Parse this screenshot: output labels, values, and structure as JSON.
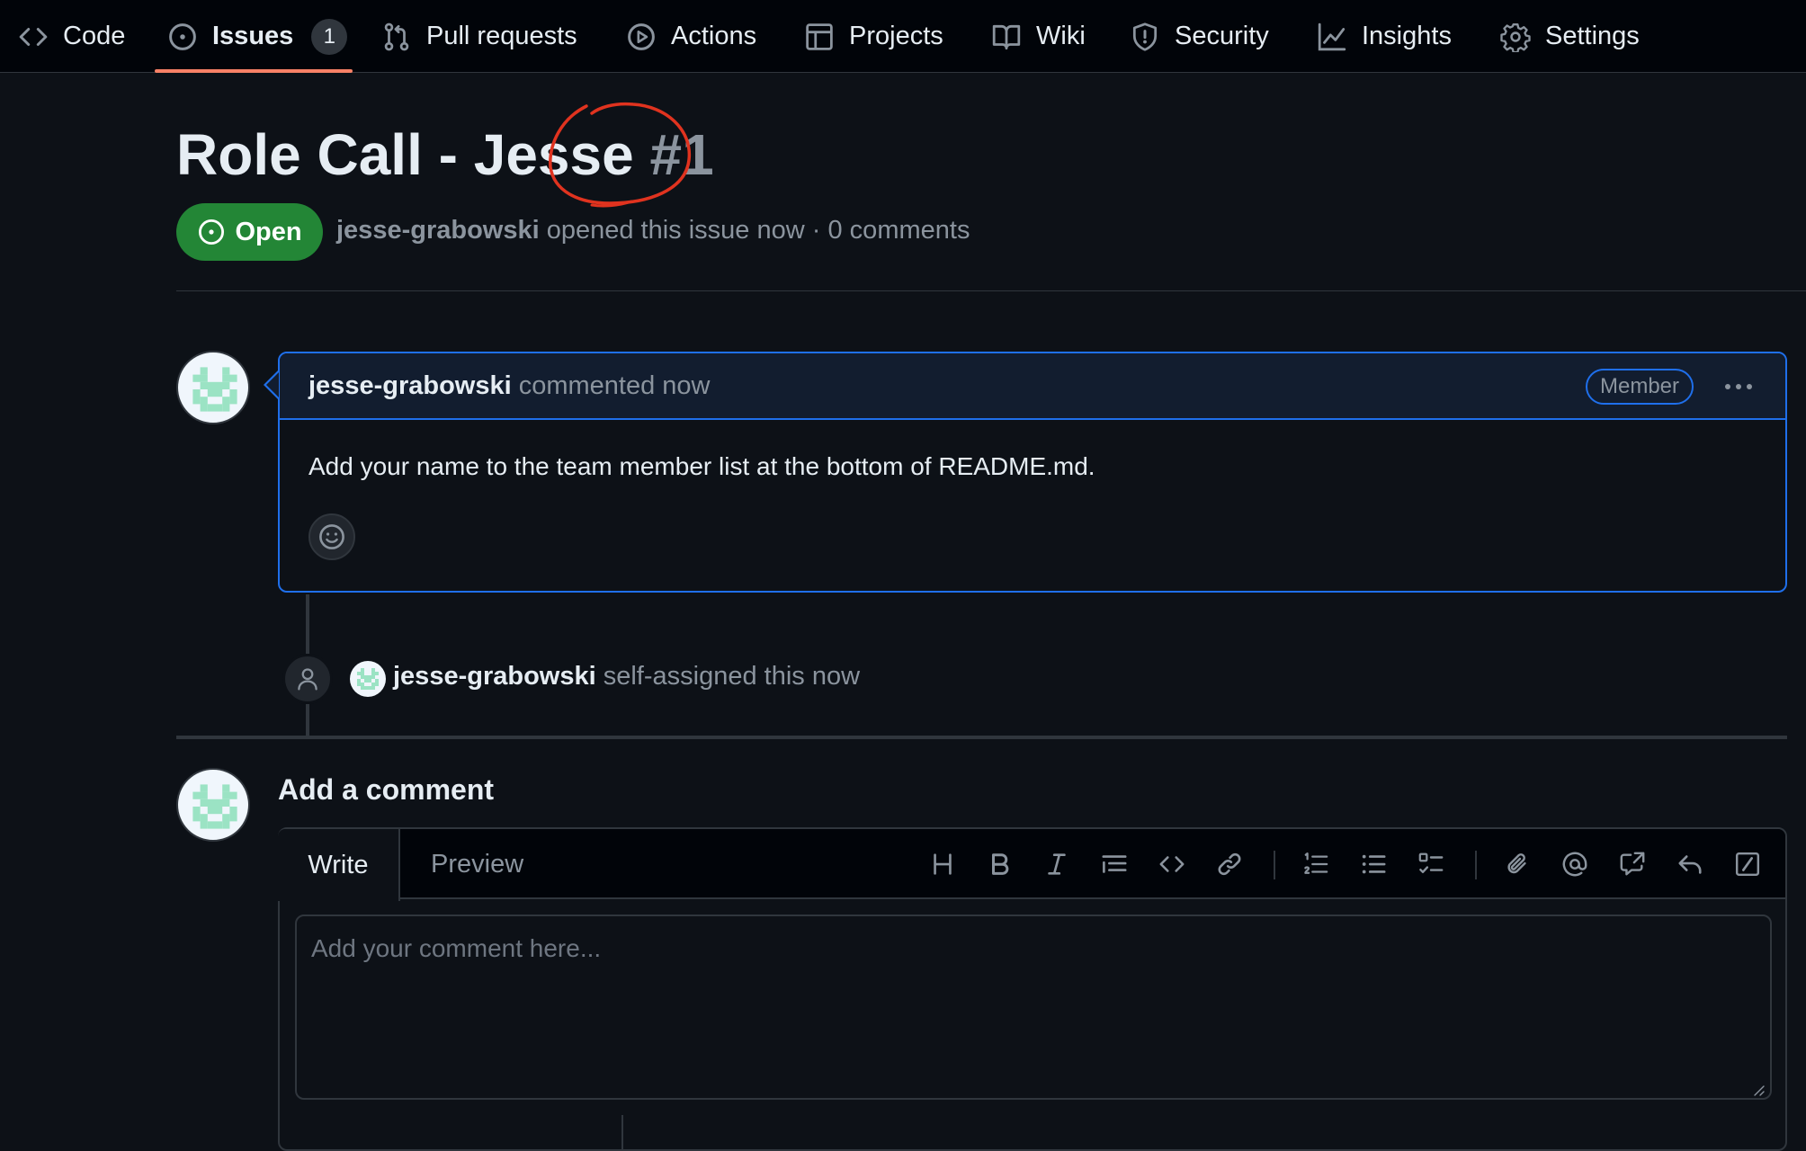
{
  "nav": {
    "items": [
      {
        "id": "code",
        "label": "Code",
        "icon": "code-icon"
      },
      {
        "id": "issues",
        "label": "Issues",
        "icon": "issue-opened-icon",
        "count": "1",
        "active": true
      },
      {
        "id": "pulls",
        "label": "Pull requests",
        "icon": "git-pull-request-icon"
      },
      {
        "id": "actions",
        "label": "Actions",
        "icon": "play-icon"
      },
      {
        "id": "projects",
        "label": "Projects",
        "icon": "table-icon"
      },
      {
        "id": "wiki",
        "label": "Wiki",
        "icon": "book-icon"
      },
      {
        "id": "security",
        "label": "Security",
        "icon": "shield-icon"
      },
      {
        "id": "insights",
        "label": "Insights",
        "icon": "graph-icon"
      },
      {
        "id": "settings",
        "label": "Settings",
        "icon": "gear-icon"
      }
    ],
    "accent": "#f78166"
  },
  "issue": {
    "title": "Role Call - Jesse",
    "number": "#1",
    "status": "Open",
    "status_color": "#238636",
    "author": "jesse-grabowski",
    "meta_action": "opened this issue now",
    "meta_sep": "·",
    "comment_count": "0 comments",
    "annotation_color": "#e0331f"
  },
  "comment": {
    "author": "jesse-grabowski",
    "action": "commented now",
    "badge": "Member",
    "body": "Add your name to the team member list at the bottom of README.md.",
    "border_color": "#1f6feb"
  },
  "timeline_event": {
    "icon": "person-icon",
    "author": "jesse-grabowski",
    "action": "self-assigned this now"
  },
  "add_comment": {
    "heading": "Add a comment",
    "tabs": {
      "write": "Write",
      "preview": "Preview"
    },
    "placeholder": "Add your comment here...",
    "toolbar": [
      "heading-icon",
      "bold-icon",
      "italic-icon",
      "quote-icon",
      "code-icon",
      "link-icon",
      "ordered-list-icon",
      "unordered-list-icon",
      "task-list-icon",
      "attach-icon",
      "mention-icon",
      "cross-reference-icon",
      "reply-icon",
      "slash-command-icon"
    ]
  }
}
